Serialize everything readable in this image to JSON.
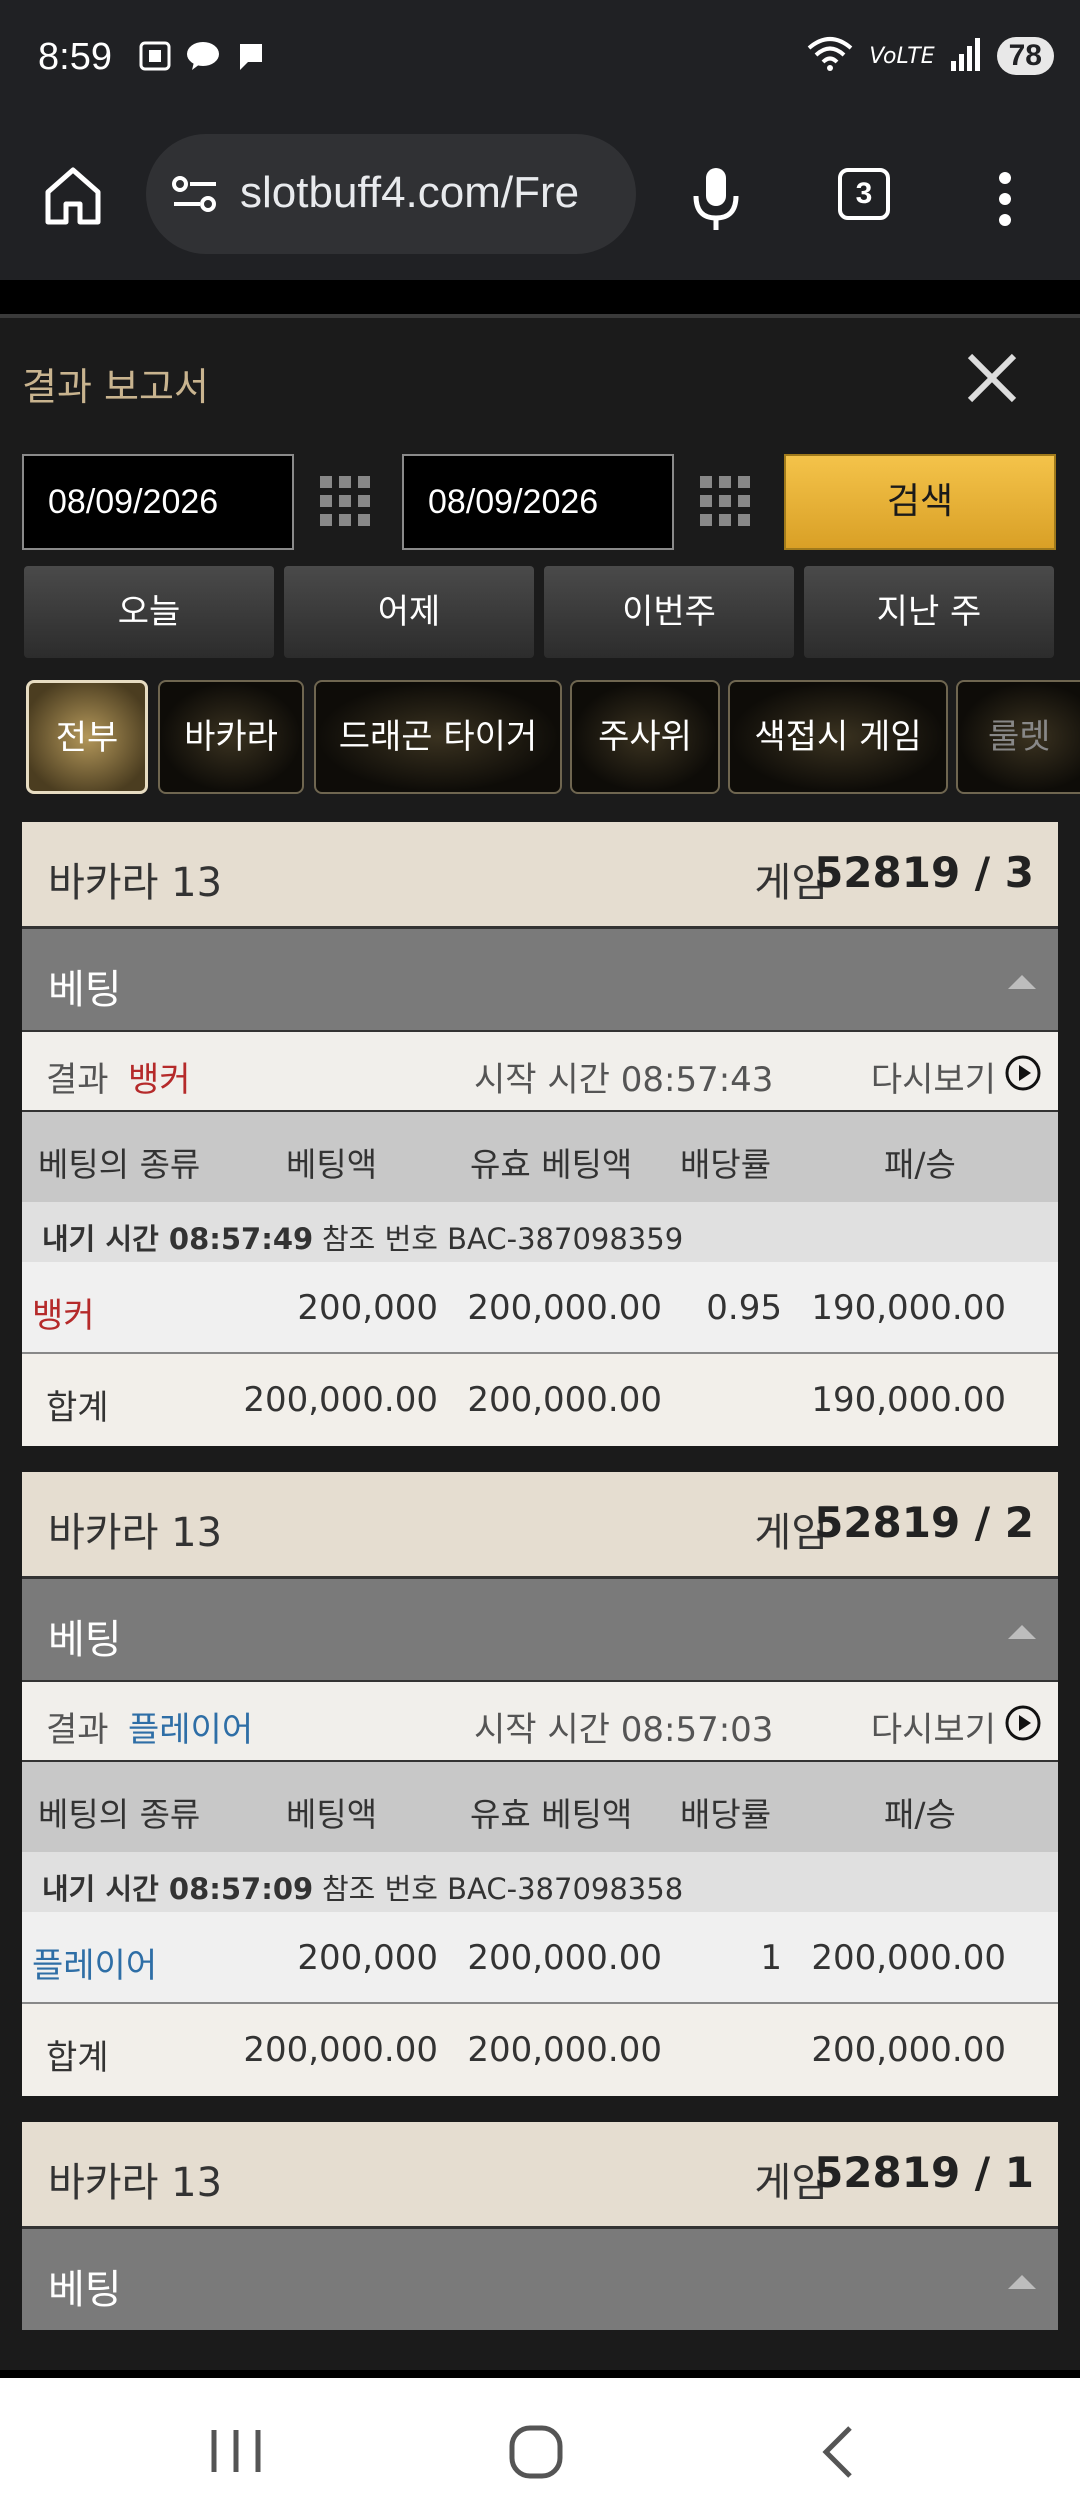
{
  "status": {
    "time": "8:59",
    "battery": "78"
  },
  "browser": {
    "url": "slotbuff4.com/Fre",
    "tab_count": "3"
  },
  "panel": {
    "title": "결과 보고서",
    "date_from": "08/09/2026",
    "date_to": "08/09/2026",
    "search_label": "검색",
    "quick": [
      "오늘",
      "어제",
      "이번주",
      "지난 주"
    ],
    "filters": [
      "전부",
      "바카라",
      "드래곤 타이거",
      "주사위",
      "색접시 게임",
      "룰렛"
    ]
  },
  "labels": {
    "game": "게임",
    "betting": "베팅",
    "result": "결과",
    "replay": "다시보기",
    "col_type": "베팅의 종류",
    "col_amount": "베팅액",
    "col_valid": "유효 베팅액",
    "col_odds": "배당률",
    "col_winloss": "패/승",
    "total": "합계"
  },
  "cards": [
    {
      "name": "바카라 13",
      "game_no": "52819 / 3",
      "result": "뱅커",
      "start": "시작 시간 08:57:43",
      "placed": "내기 시간 08:57:49",
      "ref": "참조 번호 BAC-387098359",
      "bet_type": "뱅커",
      "amount": "200,000",
      "valid": "200,000.00",
      "odds": "0.95",
      "winloss": "190,000.00",
      "sum_amount": "200,000.00",
      "sum_valid": "200,000.00",
      "sum_winloss": "190,000.00"
    },
    {
      "name": "바카라 13",
      "game_no": "52819 / 2",
      "result": "플레이어",
      "start": "시작 시간 08:57:03",
      "placed": "내기 시간 08:57:09",
      "ref": "참조 번호 BAC-387098358",
      "bet_type": "플레이어",
      "amount": "200,000",
      "valid": "200,000.00",
      "odds": "1",
      "winloss": "200,000.00",
      "sum_amount": "200,000.00",
      "sum_valid": "200,000.00",
      "sum_winloss": "200,000.00"
    },
    {
      "name": "바카라 13",
      "game_no": "52819 / 1"
    }
  ]
}
